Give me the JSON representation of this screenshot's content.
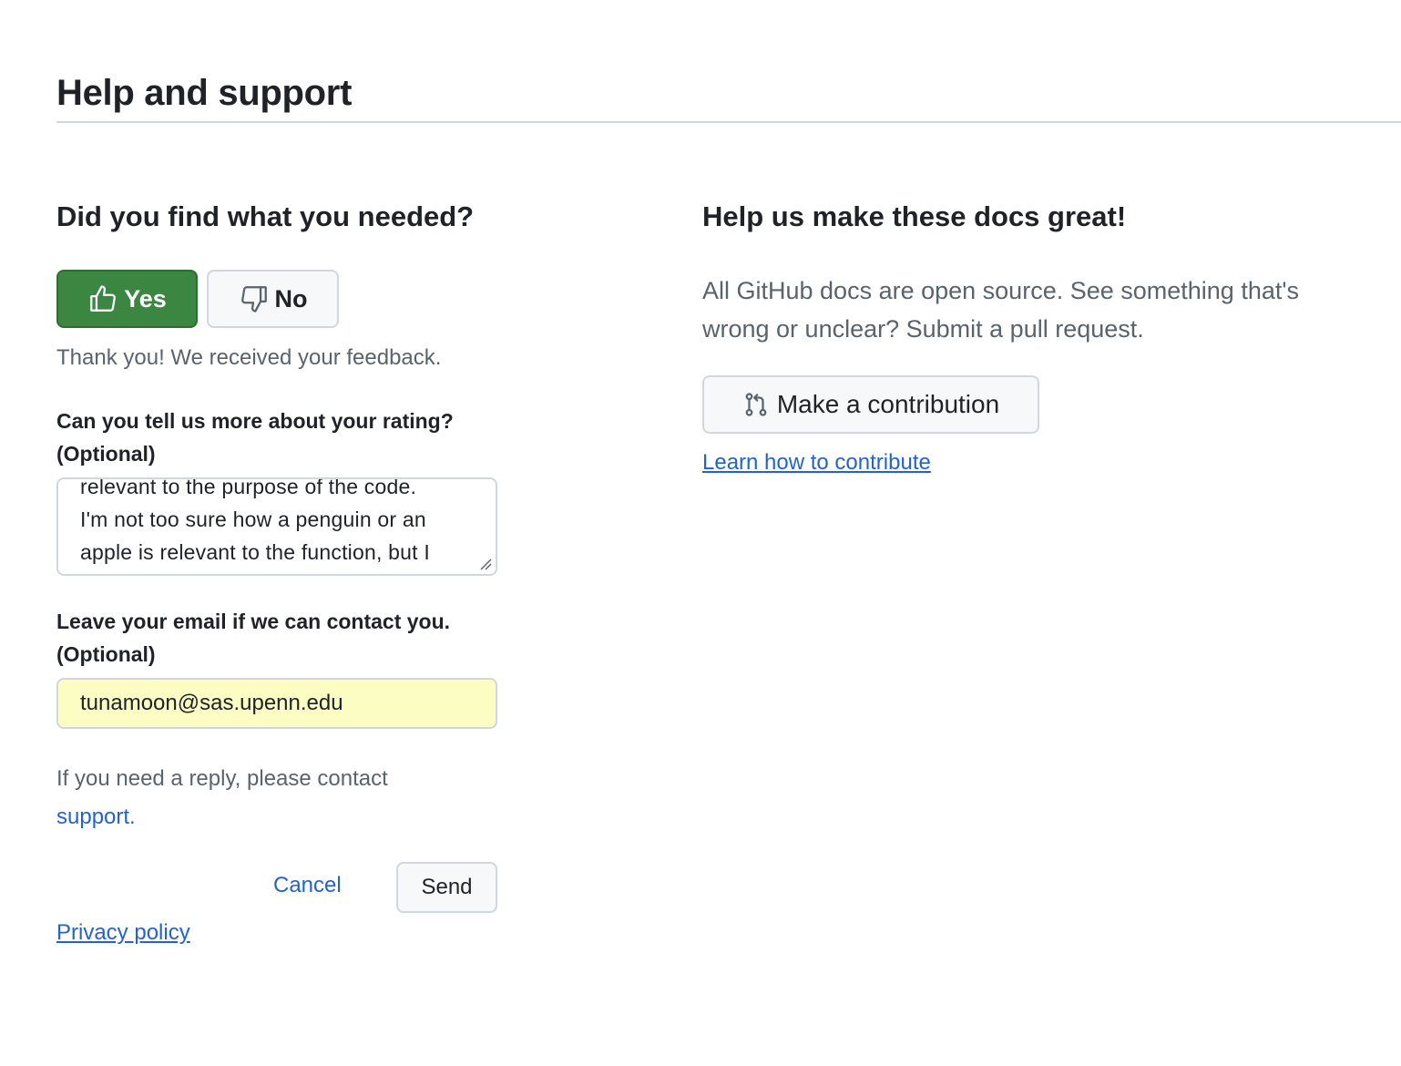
{
  "page": {
    "title": "Help and support"
  },
  "feedback": {
    "heading": "Did you find what you needed?",
    "yes_label": "Yes",
    "no_label": "No",
    "thanks": "Thank you! We received your feedback.",
    "rating_label_line1": "Can you tell us more about your rating?",
    "rating_label_line2": "(Optional)",
    "rating_text": "relevant to the purpose of the code.\nI'm not too sure how a penguin or an\napple is relevant to the function, but I",
    "email_label_line1": "Leave your email if we can contact you.",
    "email_label_line2": "(Optional)",
    "email_value": "tunamoon@sas.upenn.edu",
    "reply_text": "If you need a reply, please contact",
    "support_link": "support.",
    "cancel_label": "Cancel",
    "send_label": "Send",
    "privacy_label": "Privacy policy"
  },
  "contribute": {
    "heading": "Help us make these docs great!",
    "description": "All GitHub docs are open source. See something that's wrong or unclear? Submit a pull request.",
    "button_label": "Make a contribution",
    "learn_link": "Learn how to contribute"
  },
  "colors": {
    "accent_green": "#3b8640",
    "link_blue": "#2163d0",
    "muted_text": "#59636e",
    "autofill_yellow": "#fbfdc3"
  },
  "icons": {
    "yes": "thumbs-up-icon",
    "no": "thumbs-down-icon",
    "contribute": "git-pull-request-icon"
  }
}
